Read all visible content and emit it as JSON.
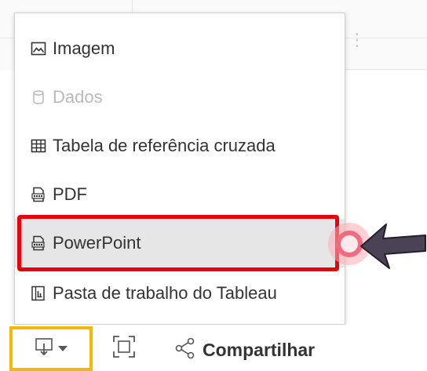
{
  "menu": {
    "items": [
      {
        "label": "Imagem",
        "icon": "image-icon",
        "disabled": false,
        "highlighted": false
      },
      {
        "label": "Dados",
        "icon": "database-icon",
        "disabled": true,
        "highlighted": false
      },
      {
        "label": "Tabela de referência cruzada",
        "icon": "crosstab-icon",
        "disabled": false,
        "highlighted": false
      },
      {
        "label": "PDF",
        "icon": "pdf-file-icon",
        "disabled": false,
        "highlighted": false
      },
      {
        "label": "PowerPoint",
        "icon": "ppt-file-icon",
        "disabled": false,
        "highlighted": true
      },
      {
        "label": "Pasta de trabalho do Tableau",
        "icon": "tableau-workbook-icon",
        "disabled": false,
        "highlighted": false
      }
    ]
  },
  "toolbar": {
    "download_icon": "download-icon",
    "fit_icon": "fit-screen-icon",
    "share_label": "Compartilhar",
    "share_icon": "share-icon"
  },
  "colors": {
    "highlight_border": "#e8000b",
    "download_button_border": "#f5b800",
    "text": "#333333",
    "disabled_text": "#b9b9b9",
    "hover_background": "#e6e6e6"
  }
}
